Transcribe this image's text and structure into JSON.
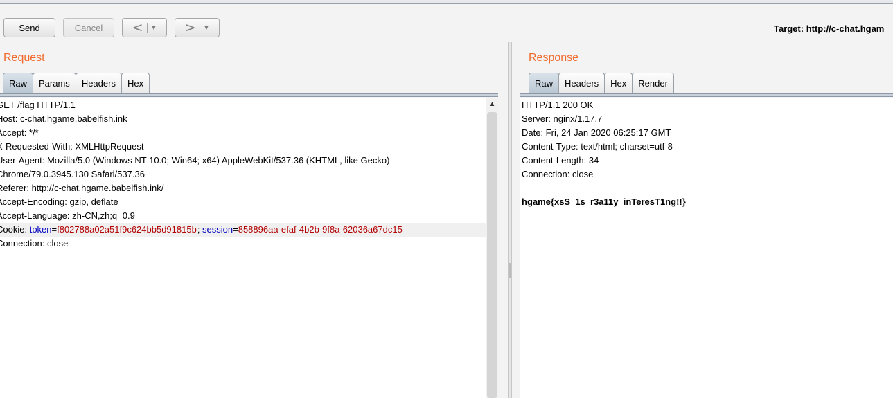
{
  "toolbar": {
    "send_label": "Send",
    "cancel_label": "Cancel",
    "back_icon": "<",
    "forward_icon": ">",
    "dropdown_icon": "▼",
    "target_text": "Target: http://c-chat.hgam"
  },
  "request": {
    "title": "Request",
    "tabs": [
      "Raw",
      "Params",
      "Headers",
      "Hex"
    ],
    "active_tab": "Raw",
    "lines": [
      "GET /flag HTTP/1.1",
      "Host: c-chat.hgame.babelfish.ink",
      "Accept: */*",
      "X-Requested-With: XMLHttpRequest",
      "User-Agent: Mozilla/5.0 (Windows NT 10.0; Win64; x64) AppleWebKit/537.36 (KHTML, like Gecko)",
      "Chrome/79.0.3945.130 Safari/537.36",
      "Referer: http://c-chat.hgame.babelfish.ink/",
      "Accept-Encoding: gzip, deflate",
      "Accept-Language: zh-CN,zh;q=0.9"
    ],
    "cookie": {
      "prefix": "Cookie: ",
      "token_key": "token",
      "token_value": "f802788a02a51f9c624bb5d91815b",
      "sep": "; ",
      "session_key": "session",
      "session_value": "858896aa-efaf-4b2b-9f8a-62036a67dc15"
    },
    "last_line": "Connection: close",
    "scroll_up_icon": "▲"
  },
  "response": {
    "title": "Response",
    "tabs": [
      "Raw",
      "Headers",
      "Hex",
      "Render"
    ],
    "active_tab": "Raw",
    "lines": [
      "HTTP/1.1 200 OK",
      "Server: nginx/1.17.7",
      "Date: Fri, 24 Jan 2020 06:25:17 GMT",
      "Content-Type: text/html; charset=utf-8",
      "Content-Length: 34",
      "Connection: close"
    ],
    "body": "hgame{xsS_1s_r3a11y_inTeresT1ng!!}"
  },
  "colors": {
    "accent": "#f06a2c",
    "cookie_key": "#0000c0",
    "cookie_value": "#b30000"
  }
}
